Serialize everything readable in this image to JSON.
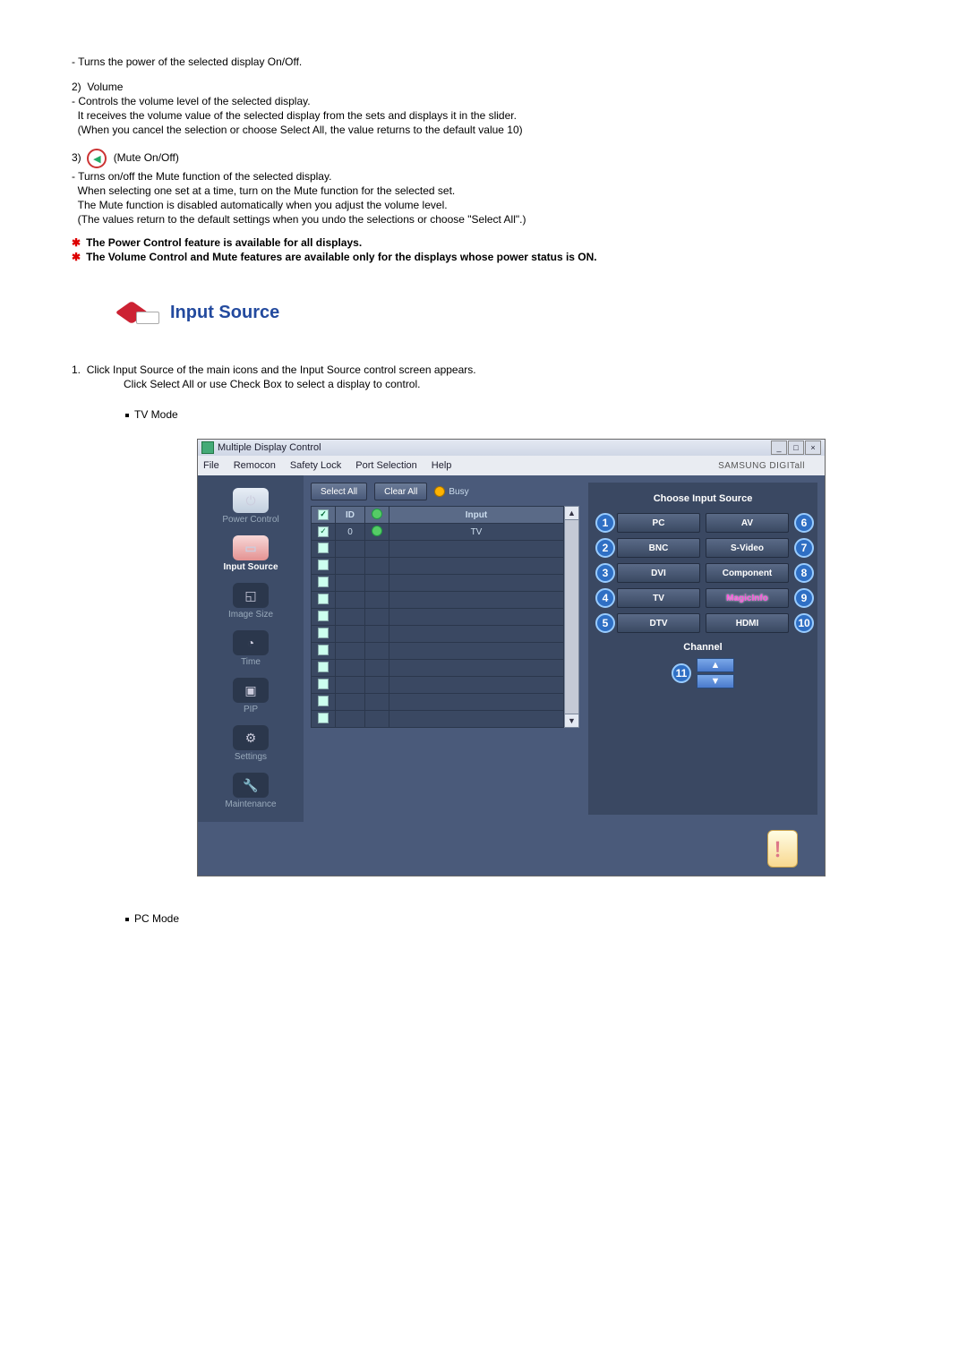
{
  "power_off_desc": "Turns the power of the selected display On/Off.",
  "volume": {
    "num": "2)",
    "title": "Volume",
    "l1": "Controls the volume level of the selected display.",
    "l2": "It receives the volume value of the selected display from the sets and displays it in the slider.",
    "l3": "(When you cancel the selection or choose Select All, the value returns to the default value 10)"
  },
  "mute": {
    "num": "3)",
    "title": "(Mute On/Off)",
    "l1": "Turns on/off the Mute function of the selected display.",
    "l2": "When selecting one set at a time, turn on the Mute function for the selected set.",
    "l3": "The Mute function is disabled automatically when you adjust the volume level.",
    "l4": "(The values return to the default settings when you undo the selections or choose \"Select All\".)"
  },
  "note1": "The Power Control feature is available for all displays.",
  "note2": "The Volume Control and Mute features are available only for the displays whose power status is ON.",
  "section_title": "Input Source",
  "intro_num": "1.",
  "intro1": "Click Input Source of the main icons and the Input Source control screen appears.",
  "intro2": "Click Select All or use Check Box to select a display to control.",
  "tv_mode": "TV Mode",
  "pc_mode": "PC Mode",
  "app": {
    "title": "Multiple Display Control",
    "menu": [
      "File",
      "Remocon",
      "Safety Lock",
      "Port Selection",
      "Help"
    ],
    "brand": "SAMSUNG DIGITall",
    "sidebar": [
      {
        "label": "Power Control"
      },
      {
        "label": "Input Source"
      },
      {
        "label": "Image Size"
      },
      {
        "label": "Time"
      },
      {
        "label": "PIP"
      },
      {
        "label": "Settings"
      },
      {
        "label": "Maintenance"
      }
    ],
    "select_all": "Select All",
    "clear_all": "Clear All",
    "busy": "Busy",
    "th_id": "ID",
    "th_input": "Input",
    "row0_id": "0",
    "row0_input": "TV",
    "panel_title": "Choose Input Source",
    "src": {
      "n1": "1",
      "b1": "PC",
      "n6": "6",
      "b6": "AV",
      "n2": "2",
      "b2": "BNC",
      "n7": "7",
      "b7": "S-Video",
      "n3": "3",
      "b3": "DVI",
      "n8": "8",
      "b8": "Component",
      "n4": "4",
      "b4": "TV",
      "n9": "9",
      "b9": "MagicInfo",
      "n5": "5",
      "b5": "DTV",
      "n10": "10",
      "b10": "HDMI"
    },
    "channel": "Channel",
    "n11": "11"
  }
}
